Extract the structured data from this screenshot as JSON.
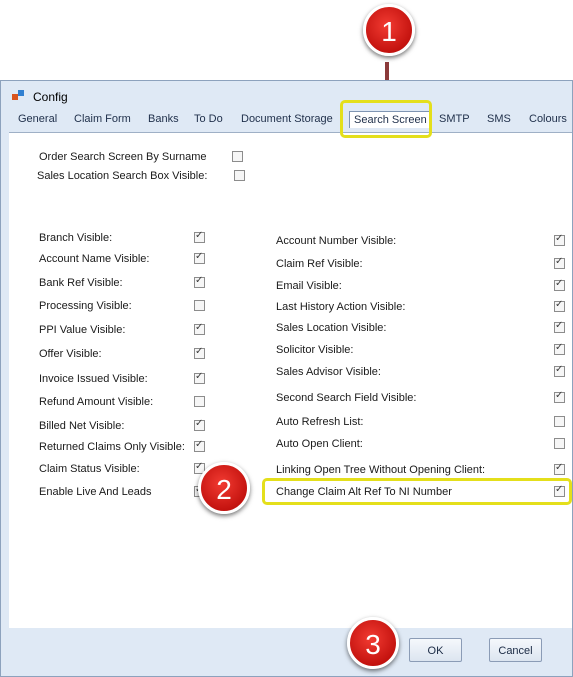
{
  "window": {
    "title": "Config"
  },
  "tabs": [
    "General",
    "Claim Form",
    "Banks",
    "To Do",
    "Document Storage",
    "Search Screen",
    "SMTP",
    "SMS",
    "Colours"
  ],
  "top_options": [
    {
      "label": "Order Search Screen By Surname",
      "checked": false
    },
    {
      "label": "Sales Location Search Box Visible:",
      "checked": false
    }
  ],
  "left_options": [
    {
      "label": "Branch Visible:",
      "checked": true
    },
    {
      "label": "Account Name Visible:",
      "checked": true
    },
    {
      "label": "Bank Ref Visible:",
      "checked": true
    },
    {
      "label": "Processing Visible:",
      "checked": false
    },
    {
      "label": "PPI Value Visible:",
      "checked": true
    },
    {
      "label": "Offer Visible:",
      "checked": true
    },
    {
      "label": "Invoice Issued Visible:",
      "checked": true
    },
    {
      "label": "Refund Amount Visible:",
      "checked": false
    },
    {
      "label": "Billed Net Visible:",
      "checked": true
    },
    {
      "label": "Returned Claims Only Visible:",
      "checked": true
    },
    {
      "label": "Claim Status Visible:",
      "checked": true
    },
    {
      "label": "Enable Live And Leads",
      "checked": true
    }
  ],
  "right_options": [
    {
      "label": "Account Number Visible:",
      "checked": true
    },
    {
      "label": "Claim Ref Visible:",
      "checked": true
    },
    {
      "label": "Email Visible:",
      "checked": true
    },
    {
      "label": "Last History Action Visible:",
      "checked": true
    },
    {
      "label": "Sales Location Visible:",
      "checked": true
    },
    {
      "label": "Solicitor Visible:",
      "checked": true
    },
    {
      "label": "Sales Advisor Visible:",
      "checked": true
    },
    {
      "label": "Second Search Field Visible:",
      "checked": true
    },
    {
      "label": "Auto Refresh List:",
      "checked": false
    },
    {
      "label": "Auto Open Client:",
      "checked": false
    },
    {
      "label": "Linking Open Tree Without Opening Client:",
      "checked": true
    },
    {
      "label": "Change Claim Alt Ref To NI Number",
      "checked": true
    }
  ],
  "buttons": {
    "ok": "OK",
    "cancel": "Cancel"
  },
  "annotations": [
    "1",
    "2",
    "3"
  ]
}
